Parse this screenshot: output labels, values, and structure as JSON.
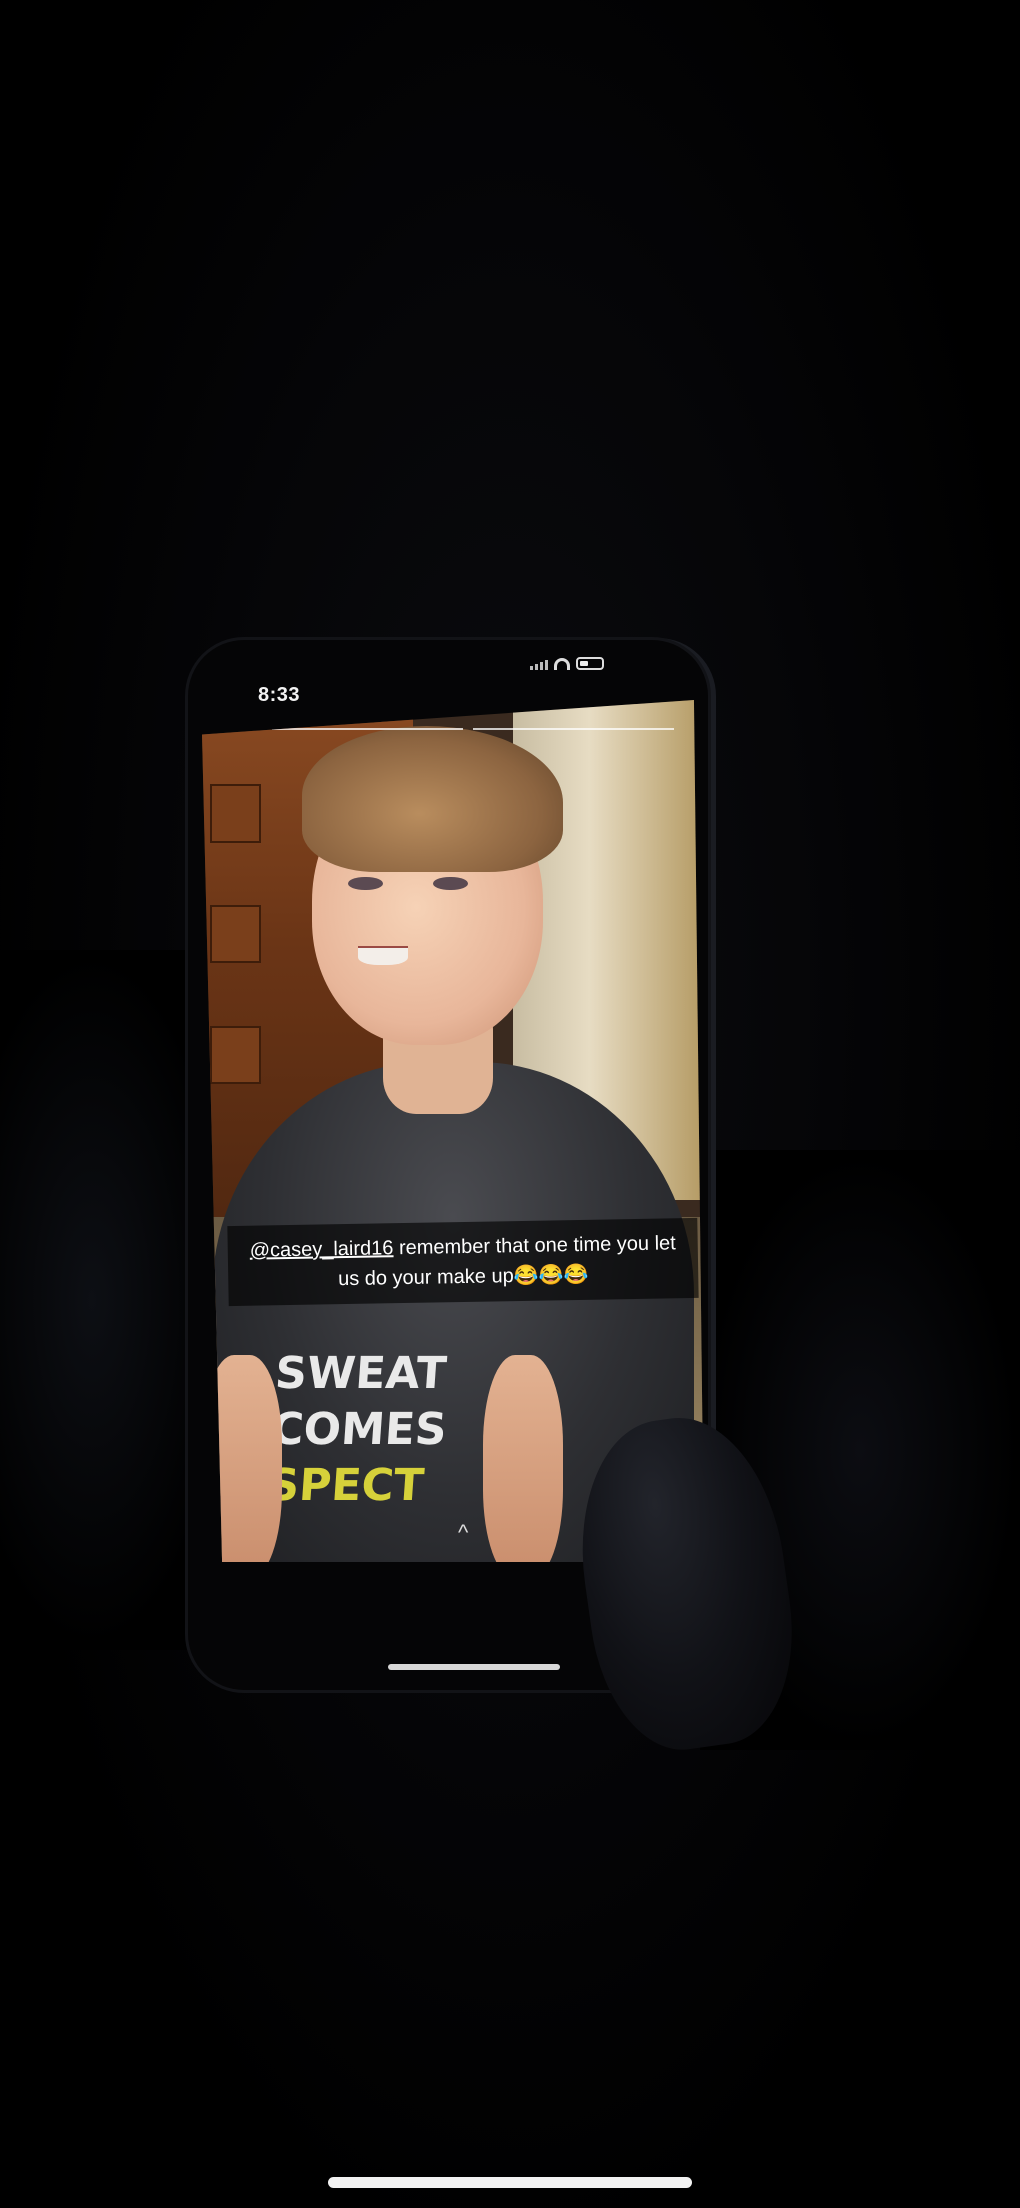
{
  "phone_screen": {
    "status_time": "8:33",
    "caption": {
      "mention": "@casey_laird16",
      "line1_rest": " remember that one time you let",
      "line2": "us do your make up😂😂😂"
    },
    "shirt_print": [
      "SWEAT",
      "COMES",
      "SPECT"
    ],
    "swipe_up_glyph": "^"
  },
  "icons": {
    "signal": "cellular-signal-icon",
    "wifi": "wifi-icon",
    "battery": "battery-icon",
    "swipe_up": "chevron-up-icon"
  },
  "colors": {
    "background": "#000000",
    "caption_bg": "rgba(0,0,0,0.62)",
    "home_indicator": "#f2f2f2"
  }
}
